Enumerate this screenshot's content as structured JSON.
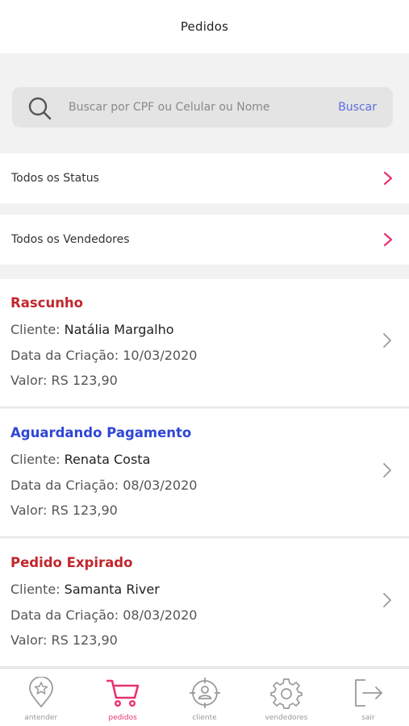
{
  "header": {
    "title": "Pedidos"
  },
  "search": {
    "placeholder": "Buscar por CPF ou Celular ou Nome",
    "value": "",
    "button_label": "Buscar"
  },
  "filters": {
    "status_label": "Todos os Status",
    "sellers_label": "Todos os Vendedores"
  },
  "orders": [
    {
      "status": "Rascunho",
      "status_color": "#c0272d",
      "client_label": "Cliente:",
      "client_name": "Natália Margalho",
      "date_text": "Data da Criação: 10/03/2020",
      "value_text": "Valor: RS 123,90"
    },
    {
      "status": "Aguardando Pagamento",
      "status_color": "#2f46d6",
      "client_label": "Cliente:",
      "client_name": "Renata Costa",
      "date_text": "Data da Criação: 08/03/2020",
      "value_text": "Valor: RS 123,90"
    },
    {
      "status": "Pedido Expirado",
      "status_color": "#c0272d",
      "client_label": "Cliente:",
      "client_name": "Samanta River",
      "date_text": "Data da Criação: 08/03/2020",
      "value_text": "Valor: RS 123,90"
    }
  ],
  "tabs": [
    {
      "label": "antender",
      "icon": "map-pin-star-icon",
      "active": false
    },
    {
      "label": "pedidos",
      "icon": "shopping-cart-icon",
      "active": true
    },
    {
      "label": "cliente",
      "icon": "user-target-icon",
      "active": false
    },
    {
      "label": "vendedores",
      "icon": "gear-icon",
      "active": false
    },
    {
      "label": "sair",
      "icon": "logout-icon",
      "active": false
    }
  ],
  "colors": {
    "accent": "#e8336d",
    "link": "#5b6ee1",
    "icon_gray": "#9a9a9a"
  }
}
